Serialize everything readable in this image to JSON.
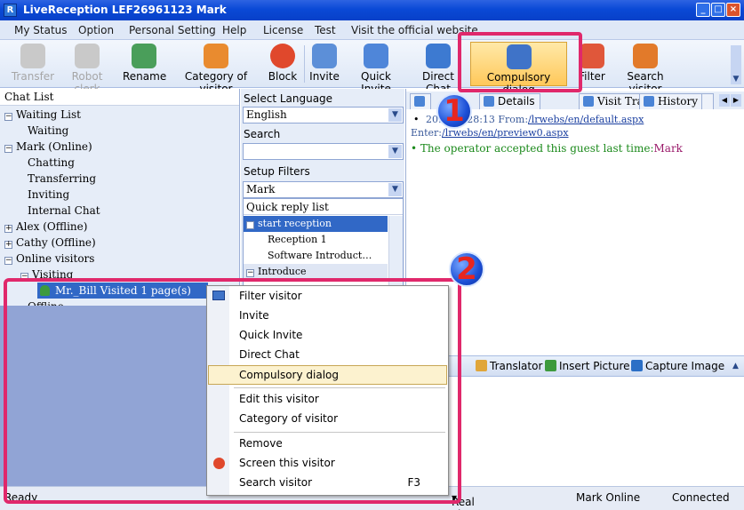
{
  "window": {
    "title": "LiveReception   LEF26961123 Mark",
    "app_icon": "R"
  },
  "menu": [
    "My Status",
    "Option",
    "Personal Setting",
    "Help",
    "License",
    "Test",
    "Visit the official website"
  ],
  "toolbar": {
    "transfer": "Transfer",
    "robot_clerk": "Robot clerk",
    "rename": "Rename",
    "category": "Category of visitor",
    "block": "Block",
    "invite": "Invite",
    "quick_invite": "Quick Invite",
    "direct_chat": "Direct Chat",
    "compulsory": "Compulsory dialog",
    "filter": "Filter",
    "search_visitor": "Search visitor"
  },
  "left": {
    "header": "Chat List",
    "waiting_list": "Waiting List",
    "waiting": "Waiting",
    "mark": "Mark (Online)",
    "chatting": "Chatting",
    "transferring": "Transferring",
    "inviting": "Inviting",
    "internal_chat": "Internal Chat",
    "alex": "Alex (Offline)",
    "cathy": "Cathy (Offline)",
    "online_visitors": "Online visitors",
    "visiting": "Visiting",
    "visitor": "Mr._Bill Visited 1 page(s)",
    "offline": "Offline"
  },
  "middle": {
    "select_language_label": "Select Language",
    "language_value": "English",
    "search_label": "Search",
    "search_value": "",
    "filters_label": "Setup Filters",
    "filters_value": "Mark",
    "quick_reply_header": "Quick reply list",
    "start_reception": "start reception",
    "reception1": "Reception 1",
    "software_intro": "Software  Introduct…",
    "introduce": "Introduce"
  },
  "right": {
    "tab_details": "Details",
    "tab_visit_track": "Visit Track",
    "tab_history": "History",
    "log_time": "20… 11:28:13 From:",
    "log_from": "/lrwebs/en/default.aspx",
    "log_enter": "Enter:",
    "log_enter_url": "/lrwebs/en/preview0.aspx",
    "log_msg_prefix": "The operator accepted this guest last time:",
    "log_msg_name": "Mark",
    "translator": "Translator",
    "insert_picture": "Insert Picture",
    "capture_image": "Capture Image"
  },
  "context_menu": {
    "filter_visitor": "Filter visitor",
    "invite": "Invite",
    "quick_invite": "Quick Invite",
    "direct_chat": "Direct Chat",
    "compulsory": "Compulsory dialog",
    "edit_visitor": "Edit this visitor",
    "category": "Category of visitor",
    "remove": "Remove",
    "screen": "Screen this visitor",
    "search": "Search visitor",
    "search_shortcut": "F3"
  },
  "status": {
    "ready": "Ready",
    "stat": "Real Time Statistic",
    "operator": "Mark Online",
    "conn": "Connected"
  },
  "badges": {
    "one": "1",
    "two": "2"
  },
  "colors": {
    "accent": "#0a49d6",
    "annotation": "#e0286b",
    "highlight": "#ffc85a"
  }
}
